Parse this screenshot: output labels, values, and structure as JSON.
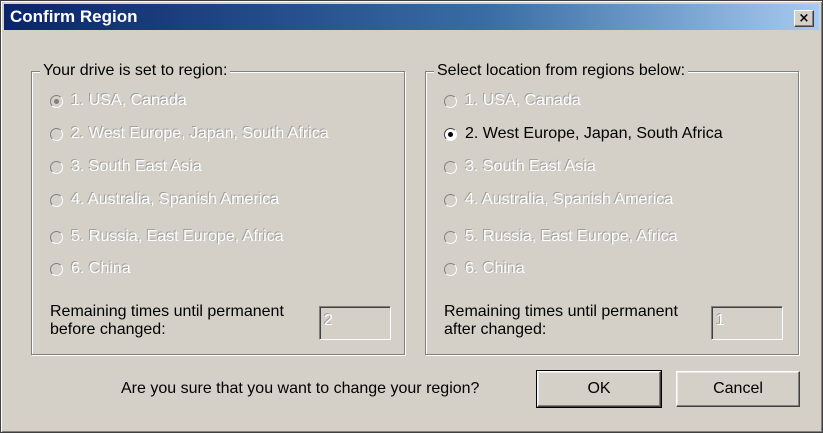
{
  "window": {
    "title": "Confirm Region",
    "close_label": "×"
  },
  "left_group": {
    "legend": "Your drive is set to region:",
    "regions": [
      "1. USA, Canada",
      "2. West Europe, Japan, South Africa",
      "3. South East Asia",
      "4. Australia, Spanish America",
      "5. Russia, East Europe, Africa",
      "6. China"
    ],
    "selected_index": 0,
    "remaining_label_line1": "Remaining times until permanent",
    "remaining_label_line2": "before changed:",
    "remaining_value": "2"
  },
  "right_group": {
    "legend": "Select location from regions below:",
    "regions": [
      "1. USA, Canada",
      "2. West Europe, Japan, South Africa",
      "3. South East Asia",
      "4. Australia, Spanish America",
      "5. Russia, East Europe, Africa",
      "6. China"
    ],
    "selected_index": 1,
    "remaining_label_line1": "Remaining times until permanent",
    "remaining_label_line2": "after changed:",
    "remaining_value": "1"
  },
  "footer": {
    "question": "Are you sure that you want to change your region?",
    "ok_label": "OK",
    "cancel_label": "Cancel"
  }
}
